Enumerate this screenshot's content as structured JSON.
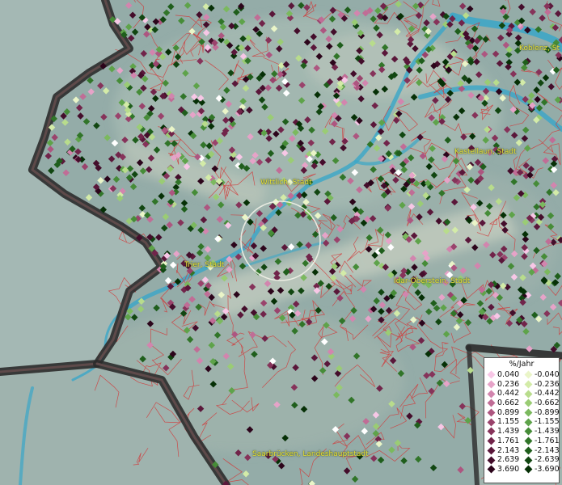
{
  "cities": [
    {
      "label": "Koblenz, St"
    },
    {
      "label": "Kastellaun, Stadt"
    },
    {
      "label": "Wittlich, Stadt"
    },
    {
      "label": "Trier, Stadt"
    },
    {
      "label": "Idar-Oberstein, Stadt"
    },
    {
      "label": "Saarbrücken, Landeshauptstadt"
    }
  ],
  "legend": {
    "title": "%/Jahr",
    "positive": [
      {
        "value": "0.040",
        "color": "#f7c7e6"
      },
      {
        "value": "0.236",
        "color": "#e6a3c8"
      },
      {
        "value": "0.442",
        "color": "#d285ae"
      },
      {
        "value": "0.662",
        "color": "#c06d96"
      },
      {
        "value": "0.899",
        "color": "#ad5680"
      },
      {
        "value": "1.155",
        "color": "#9a436c"
      },
      {
        "value": "1.439",
        "color": "#86335a"
      },
      {
        "value": "1.761",
        "color": "#71244a"
      },
      {
        "value": "2.143",
        "color": "#5a173a"
      },
      {
        "value": "2.639",
        "color": "#440d2b"
      },
      {
        "value": "3.690",
        "color": "#2c051b"
      }
    ],
    "negative": [
      {
        "value": "-0.040",
        "color": "#eaf5c8"
      },
      {
        "value": "-0.236",
        "color": "#d3eba8"
      },
      {
        "value": "-0.442",
        "color": "#b8dc8c"
      },
      {
        "value": "-0.662",
        "color": "#9acc74"
      },
      {
        "value": "-0.899",
        "color": "#7bb95e"
      },
      {
        "value": "-1.155",
        "color": "#5ea34a"
      },
      {
        "value": "-1.439",
        "color": "#468c38"
      },
      {
        "value": "-1.761",
        "color": "#317529"
      },
      {
        "value": "-2.143",
        "color": "#1f5e1c"
      },
      {
        "value": "-2.639",
        "color": "#114611"
      },
      {
        "value": "-3.690",
        "color": "#063006"
      }
    ]
  }
}
